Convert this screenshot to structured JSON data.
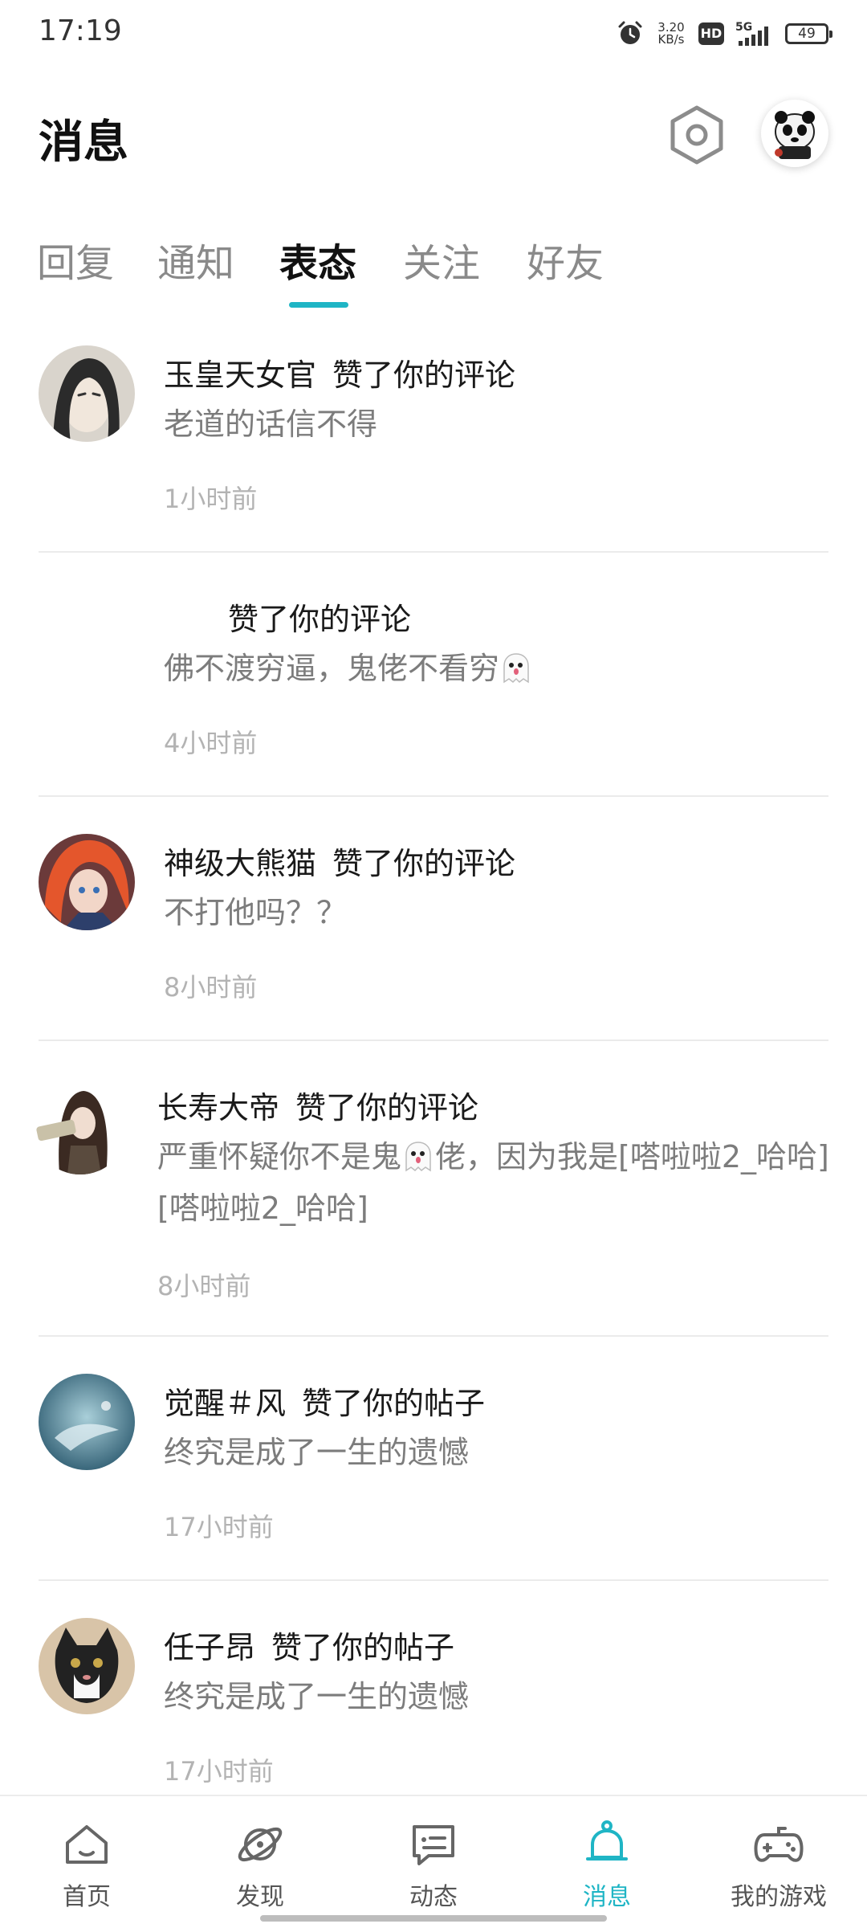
{
  "status_bar": {
    "time": "17:19",
    "speed_value": "3.20",
    "speed_unit": "KB/s",
    "hd_label": "HD",
    "network": "5G",
    "battery": "49"
  },
  "header": {
    "title": "消息",
    "settings_icon": "hexagon-settings-icon",
    "avatar_icon": "panda-avatar"
  },
  "tabs": [
    {
      "label": "回复",
      "active": false
    },
    {
      "label": "通知",
      "active": false
    },
    {
      "label": "表态",
      "active": true
    },
    {
      "label": "关注",
      "active": false
    },
    {
      "label": "好友",
      "active": false
    }
  ],
  "messages": [
    {
      "user": "玉皇天女官",
      "action": "赞了你的评论",
      "content": "老道的话信不得",
      "time": "1小时前"
    },
    {
      "user": "",
      "action": "赞了你的评论",
      "content": "佛不渡穷逼，鬼佬不看穷",
      "time": "4小时前"
    },
    {
      "user": "神级大熊猫",
      "action": "赞了你的评论",
      "content": "不打他吗？？",
      "time": "8小时前"
    },
    {
      "user": "长寿大帝",
      "action": "赞了你的评论",
      "content_part1": "严重怀疑你不是鬼",
      "content_part2": "佬，因为我是[嗒啦啦2_哈哈][嗒啦啦2_哈哈]",
      "time": "8小时前"
    },
    {
      "user": "觉醒＃风",
      "action": "赞了你的帖子",
      "content": "终究是成了一生的遗憾",
      "time": "17小时前"
    },
    {
      "user": "任子昂",
      "action": "赞了你的帖子",
      "content": "终究是成了一生的遗憾",
      "time": "17小时前"
    }
  ],
  "bottom_nav": [
    {
      "label": "首页",
      "icon": "home-icon",
      "active": false
    },
    {
      "label": "发现",
      "icon": "planet-icon",
      "active": false
    },
    {
      "label": "动态",
      "icon": "chat-icon",
      "active": false
    },
    {
      "label": "消息",
      "icon": "bell-icon",
      "active": true
    },
    {
      "label": "我的游戏",
      "icon": "gamepad-icon",
      "active": false
    }
  ],
  "colors": {
    "accent": "#1fb5c5",
    "text_primary": "#1a1a1a",
    "text_secondary": "#7c7c7c",
    "text_time": "#b3b3b3"
  }
}
